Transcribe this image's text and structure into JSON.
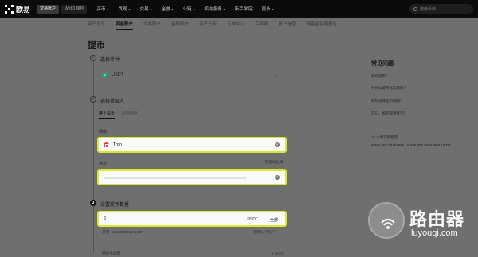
{
  "nav": {
    "logo": "欧易",
    "env_primary": "交易账户",
    "env_secondary": "Web3 钱包",
    "menu": [
      "买币",
      "发现",
      "交易",
      "金融",
      "公链",
      "机构服务",
      "新手学院",
      "更多"
    ],
    "search_placeholder": "搜索币种"
  },
  "subtabs": [
    "资产总览",
    "资金账户",
    "交易账户",
    "金融账户",
    "资产分析",
    "订单中心",
    "手续费",
    "账户信息",
    "储备金证明报告"
  ],
  "page": {
    "title": "提币",
    "step1": "选择币种",
    "coin": "USDT",
    "step2": "选择提取人",
    "method_tabs": [
      "链上提币",
      "内部转账"
    ],
    "network_label": "网络",
    "network_value": "Tron",
    "address_label": "地址",
    "manage_link": "管理地址簿 ›",
    "step3": "设置提币数量",
    "step3_number": "3",
    "amount_value": "6",
    "amount_unit": "USDT",
    "amount_all": "全部",
    "available_label": "可用",
    "available_value": "18.93093968 USDT",
    "available_right": "还剩 1 个账户",
    "fee_label": "网络手续费",
    "fee_value": "1 USDT"
  },
  "faq": {
    "title": "常见问题",
    "items": [
      "如何提币？",
      "为什么提币尚未到账？",
      "如何选择提币网络？",
      "忘记，如何取消提币？"
    ],
    "limit_label": "24 小时可用额度",
    "limit_value": "9,995,887.99384996 / 9,995,887.99384996 USDT"
  },
  "watermark": {
    "text": "路由器",
    "url": "luyouqi.com"
  },
  "colors": {
    "highlight": "#d7ea2b",
    "usdt": "#26a17b",
    "tron": "#e43c30"
  }
}
